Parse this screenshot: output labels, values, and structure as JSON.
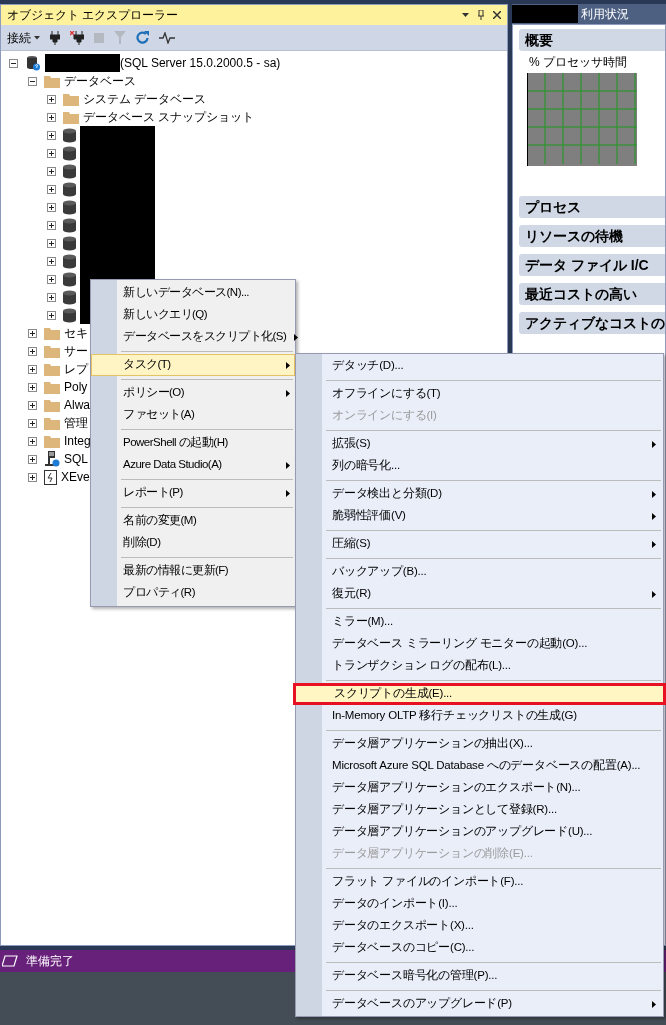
{
  "object_explorer": {
    "title": "オブジェクト エクスプローラー",
    "toolbar": {
      "connect_label": "接続"
    },
    "tree": [
      {
        "kind": "server",
        "label": "(SQL Server 15.0.2000.5 - sa)",
        "redacted": true,
        "expanded": true,
        "children": [
          {
            "kind": "folder",
            "label": "データベース",
            "expanded": true,
            "children": [
              {
                "kind": "folder",
                "label": "システム データベース",
                "expanded": false
              },
              {
                "kind": "folder",
                "label": "データベース スナップショット",
                "expanded": false
              },
              {
                "kind": "database",
                "redacted": true,
                "expanded": false
              },
              {
                "kind": "database",
                "redacted": true,
                "expanded": false
              },
              {
                "kind": "database",
                "redacted": true,
                "expanded": false
              },
              {
                "kind": "database",
                "redacted": true,
                "expanded": false
              },
              {
                "kind": "database",
                "redacted": true,
                "expanded": false
              },
              {
                "kind": "database",
                "redacted": true,
                "expanded": false
              },
              {
                "kind": "database",
                "redacted": true,
                "expanded": false
              },
              {
                "kind": "database",
                "redacted": true,
                "expanded": false
              },
              {
                "kind": "database",
                "redacted": true,
                "expanded": false
              },
              {
                "kind": "database",
                "redacted": true,
                "expanded": false
              },
              {
                "kind": "database",
                "redacted": true,
                "expanded": false
              }
            ]
          },
          {
            "kind": "folder",
            "label": "セキ",
            "expanded": false
          },
          {
            "kind": "folder",
            "label": "サー",
            "expanded": false
          },
          {
            "kind": "folder",
            "label": "レプ",
            "expanded": false
          },
          {
            "kind": "folder",
            "label": "Poly",
            "expanded": false
          },
          {
            "kind": "folder",
            "label": "Alwa",
            "expanded": false
          },
          {
            "kind": "folder",
            "label": "管理",
            "expanded": false
          },
          {
            "kind": "folder",
            "label": "Integ",
            "expanded": false
          },
          {
            "kind": "agent",
            "label": "SQL",
            "expanded": false
          },
          {
            "kind": "xevent",
            "label": "XEve",
            "expanded": false
          }
        ]
      }
    ]
  },
  "activity_monitor": {
    "title": "利用状況",
    "title_redacted": true,
    "overview": {
      "label": "概要",
      "graph_label": "% プロセッサ時間"
    },
    "sections": [
      "プロセス",
      "リソースの待機",
      "データ ファイル I/C",
      "最近コストの高い",
      "アクティブなコストの"
    ]
  },
  "context_menu": [
    {
      "kind": "item",
      "label": "新しいデータベース(N)...",
      "submenu": false,
      "selected": false
    },
    {
      "kind": "item",
      "label": "新しいクエリ(Q)",
      "submenu": false,
      "selected": false
    },
    {
      "kind": "item",
      "label": "データベースをスクリプト化(S)",
      "submenu": true,
      "selected": false
    },
    {
      "kind": "separator"
    },
    {
      "kind": "item",
      "label": "タスク(T)",
      "submenu": true,
      "selected": true
    },
    {
      "kind": "separator"
    },
    {
      "kind": "item",
      "label": "ポリシー(O)",
      "submenu": true,
      "selected": false
    },
    {
      "kind": "item",
      "label": "ファセット(A)",
      "submenu": false,
      "selected": false
    },
    {
      "kind": "separator"
    },
    {
      "kind": "item",
      "label": "PowerShell の起動(H)",
      "submenu": false,
      "selected": false
    },
    {
      "kind": "item",
      "label": "Azure Data Studio(A)",
      "submenu": true,
      "selected": false
    },
    {
      "kind": "separator"
    },
    {
      "kind": "item",
      "label": "レポート(P)",
      "submenu": true,
      "selected": false
    },
    {
      "kind": "separator"
    },
    {
      "kind": "item",
      "label": "名前の変更(M)",
      "submenu": false,
      "selected": false
    },
    {
      "kind": "item",
      "label": "削除(D)",
      "submenu": false,
      "selected": false
    },
    {
      "kind": "separator"
    },
    {
      "kind": "item",
      "label": "最新の情報に更新(F)",
      "submenu": false,
      "selected": false
    },
    {
      "kind": "item",
      "label": "プロパティ(R)",
      "submenu": false,
      "selected": false
    }
  ],
  "tasks_submenu": [
    {
      "kind": "item",
      "label": "デタッチ(D)...",
      "submenu": false,
      "disabled": false,
      "selected": false
    },
    {
      "kind": "separator"
    },
    {
      "kind": "item",
      "label": "オフラインにする(T)",
      "submenu": false,
      "disabled": false,
      "selected": false
    },
    {
      "kind": "item",
      "label": "オンラインにする(I)",
      "submenu": false,
      "disabled": true,
      "selected": false
    },
    {
      "kind": "separator"
    },
    {
      "kind": "item",
      "label": "拡張(S)",
      "submenu": true,
      "disabled": false,
      "selected": false
    },
    {
      "kind": "item",
      "label": "列の暗号化...",
      "submenu": false,
      "disabled": false,
      "selected": false
    },
    {
      "kind": "separator"
    },
    {
      "kind": "item",
      "label": "データ検出と分類(D)",
      "submenu": true,
      "disabled": false,
      "selected": false
    },
    {
      "kind": "item",
      "label": "脆弱性評価(V)",
      "submenu": true,
      "disabled": false,
      "selected": false
    },
    {
      "kind": "separator"
    },
    {
      "kind": "item",
      "label": "圧縮(S)",
      "submenu": true,
      "disabled": false,
      "selected": false
    },
    {
      "kind": "separator"
    },
    {
      "kind": "item",
      "label": "バックアップ(B)...",
      "submenu": false,
      "disabled": false,
      "selected": false
    },
    {
      "kind": "item",
      "label": "復元(R)",
      "submenu": true,
      "disabled": false,
      "selected": false
    },
    {
      "kind": "separator"
    },
    {
      "kind": "item",
      "label": "ミラー(M)...",
      "submenu": false,
      "disabled": false,
      "selected": false
    },
    {
      "kind": "item",
      "label": "データベース ミラーリング モニターの起動(O)...",
      "submenu": false,
      "disabled": false,
      "selected": false
    },
    {
      "kind": "item",
      "label": "トランザクション ログの配布(L)...",
      "submenu": false,
      "disabled": false,
      "selected": false
    },
    {
      "kind": "separator"
    },
    {
      "kind": "item",
      "label": "スクリプトの生成(E)...",
      "submenu": false,
      "disabled": false,
      "selected": true
    },
    {
      "kind": "item",
      "label": "In-Memory OLTP 移行チェックリストの生成(G)",
      "submenu": false,
      "disabled": false,
      "selected": false
    },
    {
      "kind": "separator"
    },
    {
      "kind": "item",
      "label": "データ層アプリケーションの抽出(X)...",
      "submenu": false,
      "disabled": false,
      "selected": false
    },
    {
      "kind": "item",
      "label": "Microsoft Azure SQL Database へのデータベースの配置(A)...",
      "submenu": false,
      "disabled": false,
      "selected": false
    },
    {
      "kind": "item",
      "label": "データ層アプリケーションのエクスポート(N)...",
      "submenu": false,
      "disabled": false,
      "selected": false
    },
    {
      "kind": "item",
      "label": "データ層アプリケーションとして登録(R)...",
      "submenu": false,
      "disabled": false,
      "selected": false
    },
    {
      "kind": "item",
      "label": "データ層アプリケーションのアップグレード(U)...",
      "submenu": false,
      "disabled": false,
      "selected": false
    },
    {
      "kind": "item",
      "label": "データ層アプリケーションの削除(E)...",
      "submenu": false,
      "disabled": true,
      "selected": false
    },
    {
      "kind": "separator"
    },
    {
      "kind": "item",
      "label": "フラット ファイルのインポート(F)...",
      "submenu": false,
      "disabled": false,
      "selected": false
    },
    {
      "kind": "item",
      "label": "データのインポート(I)...",
      "submenu": false,
      "disabled": false,
      "selected": false
    },
    {
      "kind": "item",
      "label": "データのエクスポート(X)...",
      "submenu": false,
      "disabled": false,
      "selected": false
    },
    {
      "kind": "item",
      "label": "データベースのコピー(C)...",
      "submenu": false,
      "disabled": false,
      "selected": false
    },
    {
      "kind": "separator"
    },
    {
      "kind": "item",
      "label": "データベース暗号化の管理(P)...",
      "submenu": false,
      "disabled": false,
      "selected": false
    },
    {
      "kind": "separator"
    },
    {
      "kind": "item",
      "label": "データベースのアップグレード(P)",
      "submenu": true,
      "disabled": false,
      "selected": false
    }
  ],
  "status_bar": {
    "text": "準備完了"
  }
}
